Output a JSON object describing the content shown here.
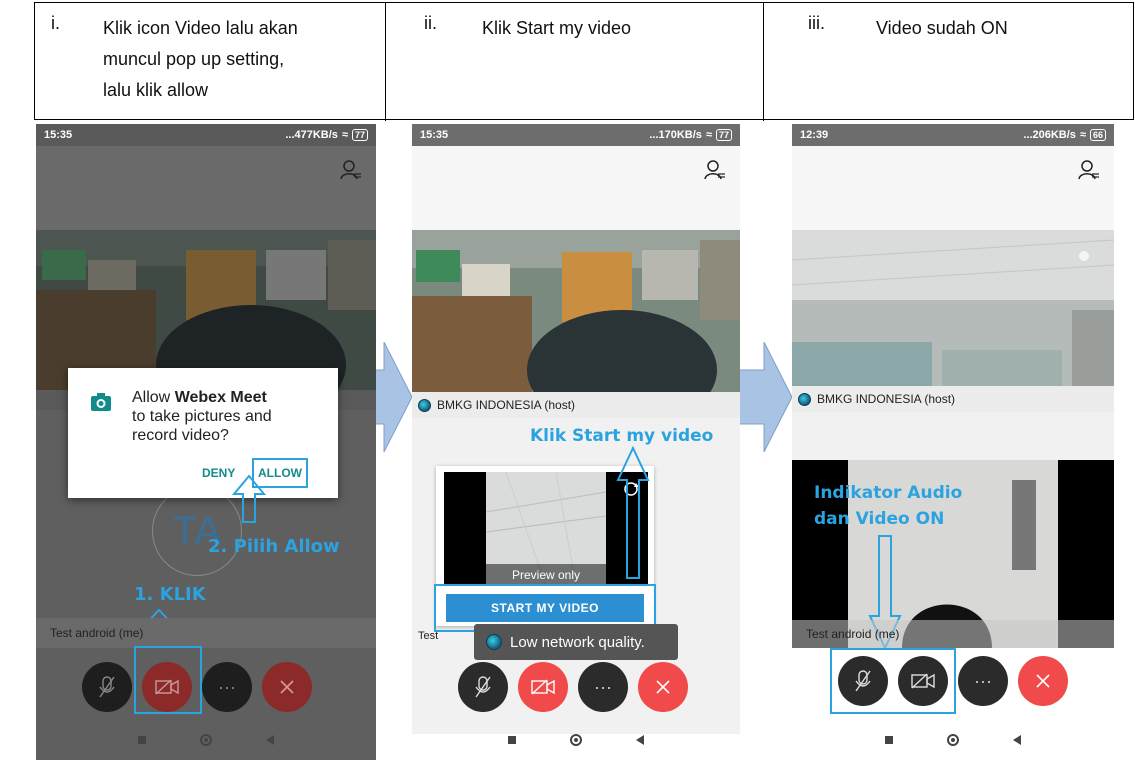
{
  "steps": [
    {
      "num": "i.",
      "text_line1": "Klik icon Video lalu akan",
      "text_line2": "muncul pop up setting,",
      "text_line3": "lalu klik allow"
    },
    {
      "num": "ii.",
      "text_line1": "Klik Start my video"
    },
    {
      "num": "iii.",
      "text_line1": "Video sudah ON"
    }
  ],
  "screens": [
    {
      "time": "15:35",
      "net": "...477KB/s",
      "battery": "77",
      "dialog": {
        "prefix": "Allow ",
        "app": "Webex Meet",
        "line2": "to take pictures and",
        "line3": "record video?",
        "deny": "DENY",
        "allow": "ALLOW"
      },
      "avatar_initials": "TA",
      "annotation_allow": "2. Pilih Allow",
      "annotation_klik": "1. KLIK",
      "self_label": "Test android (me)"
    },
    {
      "time": "15:35",
      "net": "...170KB/s",
      "battery": "77",
      "host_label": "BMKG INDONESIA (host)",
      "annotation": "Klik Start my video",
      "preview_label": "Preview only",
      "start_button": "START MY VIDEO",
      "self_label_partial": "Test",
      "toast": "Low network quality."
    },
    {
      "time": "12:39",
      "net": "...206KB/s",
      "battery": "66",
      "host_label": "BMKG INDONESIA (host)",
      "annotation_line1": "Indikator Audio",
      "annotation_line2": "dan Video ON",
      "self_label": "Test android (me)"
    }
  ],
  "colors": {
    "annotation_blue": "#2aa3e0",
    "end_call_red": "#f04a4a",
    "control_dark": "#2b2b2b",
    "button_blue": "#2c8fd1",
    "dialog_teal": "#128b8b",
    "arrow_fill": "#a8c3e4"
  },
  "icons": [
    "person-list-icon",
    "mic-off-icon",
    "video-off-icon",
    "more-icon",
    "close-icon",
    "camera-icon",
    "camera-switch-icon"
  ]
}
